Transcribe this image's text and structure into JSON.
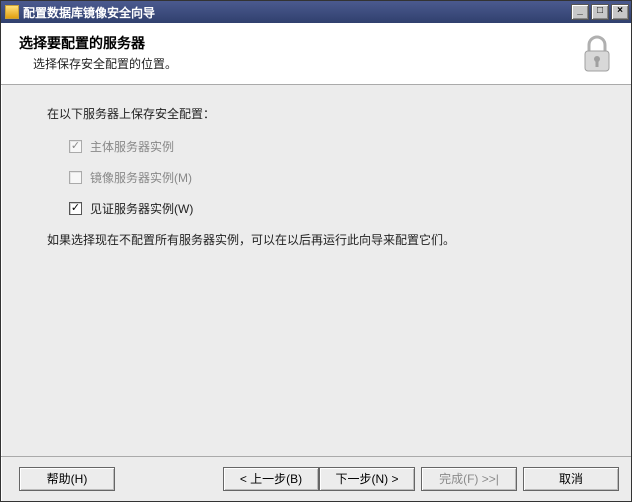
{
  "window": {
    "title": "配置数据库镜像安全向导"
  },
  "header": {
    "title": "选择要配置的服务器",
    "subtitle": "选择保存安全配置的位置。"
  },
  "content": {
    "instruction": "在以下服务器上保存安全配置：",
    "options": {
      "principal": {
        "label": "主体服务器实例",
        "checked": true
      },
      "mirror": {
        "label": "镜像服务器实例(M)",
        "checked": false
      },
      "witness": {
        "label": "见证服务器实例(W)",
        "checked": true
      }
    },
    "hint": "如果选择现在不配置所有服务器实例，可以在以后再运行此向导来配置它们。"
  },
  "footer": {
    "help": "帮助(H)",
    "back": "< 上一步(B)",
    "next": "下一步(N) >",
    "finish": "完成(F) >>|",
    "cancel": "取消"
  },
  "checkmark": "✓"
}
